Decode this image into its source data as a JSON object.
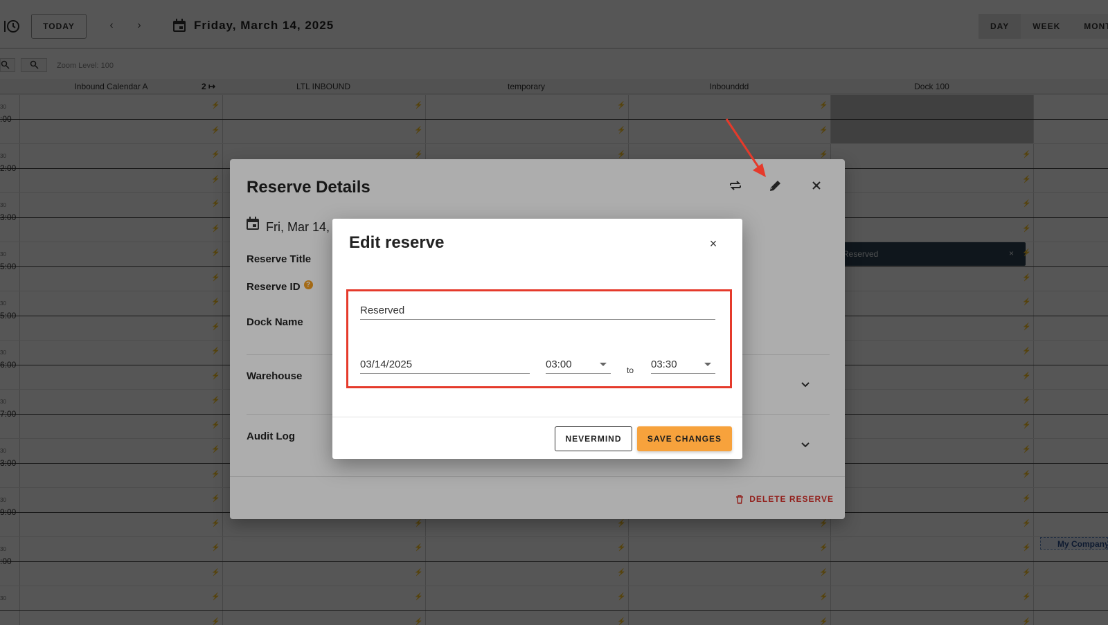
{
  "toolbar": {
    "today_label": "TODAY",
    "prev_label": "‹",
    "next_label": "›",
    "date_title": "Friday, March 14, 2025",
    "views": [
      "DAY",
      "WEEK",
      "MONT"
    ],
    "active_view": "DAY"
  },
  "zoom": {
    "label": "Zoom Level: 100"
  },
  "columns": [
    {
      "label": "Inbound Calendar A",
      "extra": "2 ↦"
    },
    {
      "label": "LTL INBOUND"
    },
    {
      "label": "temporary"
    },
    {
      "label": "Inbounddd"
    },
    {
      "label": "Dock 100"
    }
  ],
  "time_labels": [
    ":00",
    "2:00",
    "3:00",
    "5:00",
    "5:00",
    "6:00",
    "7:00",
    "3:00",
    "9:00",
    ":00"
  ],
  "half_label": "30",
  "events": {
    "reserved": "Reserved",
    "reserved_close": "×",
    "my_company": "My Company"
  },
  "details": {
    "title": "Reserve Details",
    "date": "Fri, Mar 14,",
    "labels": {
      "title": "Reserve Title",
      "id": "Reserve ID",
      "dock": "Dock Name",
      "warehouse": "Warehouse",
      "audit": "Audit Log"
    },
    "help": "?",
    "delete_label": "DELETE RESERVE"
  },
  "edit": {
    "title": "Edit reserve",
    "close": "×",
    "reserve_title_value": "Reserved",
    "date_value": "03/14/2025",
    "start_time": "03:00",
    "end_time": "03:30",
    "to_label": "to",
    "nevermind_label": "NEVERMIND",
    "save_label": "SAVE CHANGES"
  },
  "colors": {
    "accent": "#f7a23c",
    "highlight": "#e53a2b",
    "delete": "#d7302a",
    "reserved_block": "#2e4354"
  }
}
